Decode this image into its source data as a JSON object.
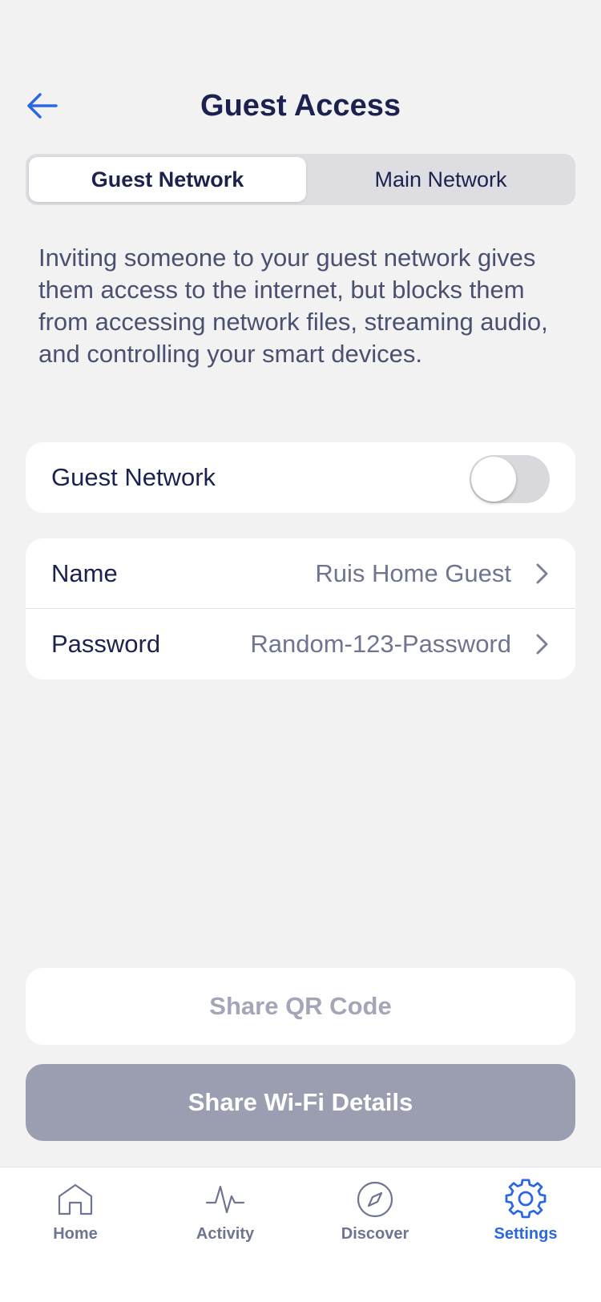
{
  "header": {
    "title": "Guest Access"
  },
  "segment": {
    "tabs": [
      {
        "label": "Guest Network",
        "active": true
      },
      {
        "label": "Main Network",
        "active": false
      }
    ]
  },
  "description": "Inviting someone to your guest network gives them access to the internet, but blocks them from accessing network files, streaming audio, and controlling your smart devices.",
  "guest_toggle": {
    "label": "Guest Network",
    "enabled": false
  },
  "details": [
    {
      "label": "Name",
      "value": "Ruis Home Guest"
    },
    {
      "label": "Password",
      "value": "Random-123-Password"
    }
  ],
  "buttons": {
    "share_qr": "Share QR Code",
    "share_wifi": "Share Wi-Fi Details"
  },
  "tabbar": {
    "items": [
      {
        "label": "Home",
        "icon": "home-icon",
        "active": false
      },
      {
        "label": "Activity",
        "icon": "activity-icon",
        "active": false
      },
      {
        "label": "Discover",
        "icon": "compass-icon",
        "active": false
      },
      {
        "label": "Settings",
        "icon": "gear-icon",
        "active": true
      }
    ]
  },
  "colors": {
    "accent": "#2b67e0",
    "text_primary": "#1c2250",
    "text_secondary": "#6e7491",
    "background": "#f2f2f3",
    "disabled_button": "#9b9eb0"
  }
}
